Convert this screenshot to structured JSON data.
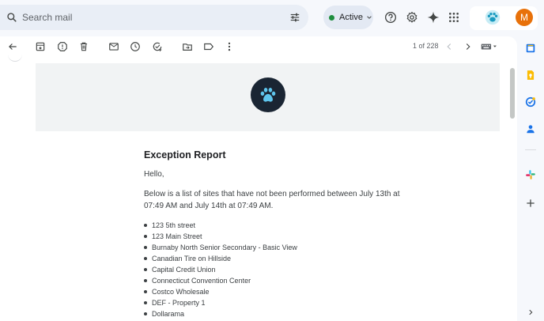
{
  "search": {
    "placeholder": "Search mail"
  },
  "status": {
    "label": "Active",
    "color": "#1e8e3e"
  },
  "account": {
    "avatar_letter": "M",
    "avatar_color": "#e8710a"
  },
  "toolbar": {
    "icons": [
      "back-arrow-icon",
      "archive-icon",
      "report-spam-icon",
      "delete-icon",
      "mark-unread-icon",
      "snooze-icon",
      "add-to-tasks-icon",
      "move-to-icon",
      "label-icon",
      "more-options-icon"
    ],
    "counter": "1 of 228"
  },
  "email": {
    "title": "Exception Report",
    "greeting": "Hello,",
    "intro": "Below is a list of sites that have not been performed between July 13th at 07:49 AM and July 14th at 07:49 AM.",
    "sites": [
      "123 5th street",
      "123 Main Street",
      "Burnaby North Senior Secondary - Basic View",
      "Canadian Tire on Hillside",
      "Capital Credit Union",
      "Connecticut Convention Center",
      "Costco Wholesale",
      "DEF - Property 1",
      "Dollarama"
    ]
  },
  "side_panel": {
    "icons": [
      "calendar-icon",
      "keep-icon",
      "tasks-icon",
      "contacts-icon",
      "slack-icon",
      "add-icon",
      "expand-chevron-icon"
    ]
  }
}
